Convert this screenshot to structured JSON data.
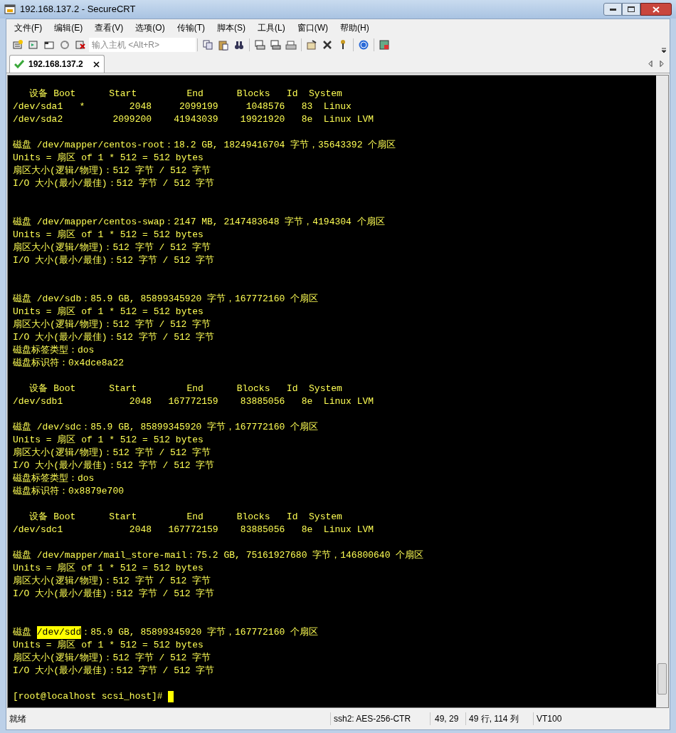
{
  "window": {
    "title": "192.168.137.2 - SecureCRT"
  },
  "menu": [
    "文件(F)",
    "编辑(E)",
    "查看(V)",
    "选项(O)",
    "传输(T)",
    "脚本(S)",
    "工具(L)",
    "窗口(W)",
    "帮助(H)"
  ],
  "toolbar": {
    "host_field": {
      "placeholder": "输入主机 <Alt+R>"
    }
  },
  "tabs": [
    {
      "label": "192.168.137.2",
      "selected": true,
      "connected": true
    }
  ],
  "terminal": {
    "lines": [
      {
        "kind": "text",
        "text": "   设备 Boot      Start         End      Blocks   Id  System"
      },
      {
        "kind": "text",
        "text": "/dev/sda1   *        2048     2099199     1048576   83  Linux"
      },
      {
        "kind": "text",
        "text": "/dev/sda2         2099200    41943039    19921920   8e  Linux LVM"
      },
      {
        "kind": "blank"
      },
      {
        "kind": "text",
        "text": "磁盘 /dev/mapper/centos-root：18.2 GB, 18249416704 字节，35643392 个扇区"
      },
      {
        "kind": "text",
        "text": "Units = 扇区 of 1 * 512 = 512 bytes"
      },
      {
        "kind": "text",
        "text": "扇区大小(逻辑/物理)：512 字节 / 512 字节"
      },
      {
        "kind": "text",
        "text": "I/O 大小(最小/最佳)：512 字节 / 512 字节"
      },
      {
        "kind": "blank"
      },
      {
        "kind": "blank"
      },
      {
        "kind": "text",
        "text": "磁盘 /dev/mapper/centos-swap：2147 MB, 2147483648 字节，4194304 个扇区"
      },
      {
        "kind": "text",
        "text": "Units = 扇区 of 1 * 512 = 512 bytes"
      },
      {
        "kind": "text",
        "text": "扇区大小(逻辑/物理)：512 字节 / 512 字节"
      },
      {
        "kind": "text",
        "text": "I/O 大小(最小/最佳)：512 字节 / 512 字节"
      },
      {
        "kind": "blank"
      },
      {
        "kind": "blank"
      },
      {
        "kind": "text",
        "text": "磁盘 /dev/sdb：85.9 GB, 85899345920 字节，167772160 个扇区"
      },
      {
        "kind": "text",
        "text": "Units = 扇区 of 1 * 512 = 512 bytes"
      },
      {
        "kind": "text",
        "text": "扇区大小(逻辑/物理)：512 字节 / 512 字节"
      },
      {
        "kind": "text",
        "text": "I/O 大小(最小/最佳)：512 字节 / 512 字节"
      },
      {
        "kind": "text",
        "text": "磁盘标签类型：dos"
      },
      {
        "kind": "text",
        "text": "磁盘标识符：0x4dce8a22"
      },
      {
        "kind": "blank"
      },
      {
        "kind": "text",
        "text": "   设备 Boot      Start         End      Blocks   Id  System"
      },
      {
        "kind": "text",
        "text": "/dev/sdb1            2048   167772159    83885056   8e  Linux LVM"
      },
      {
        "kind": "blank"
      },
      {
        "kind": "text",
        "text": "磁盘 /dev/sdc：85.9 GB, 85899345920 字节，167772160 个扇区"
      },
      {
        "kind": "text",
        "text": "Units = 扇区 of 1 * 512 = 512 bytes"
      },
      {
        "kind": "text",
        "text": "扇区大小(逻辑/物理)：512 字节 / 512 字节"
      },
      {
        "kind": "text",
        "text": "I/O 大小(最小/最佳)：512 字节 / 512 字节"
      },
      {
        "kind": "text",
        "text": "磁盘标签类型：dos"
      },
      {
        "kind": "text",
        "text": "磁盘标识符：0x8879e700"
      },
      {
        "kind": "blank"
      },
      {
        "kind": "text",
        "text": "   设备 Boot      Start         End      Blocks   Id  System"
      },
      {
        "kind": "text",
        "text": "/dev/sdc1            2048   167772159    83885056   8e  Linux LVM"
      },
      {
        "kind": "blank"
      },
      {
        "kind": "text",
        "text": "磁盘 /dev/mapper/mail_store-mail：75.2 GB, 75161927680 字节，146800640 个扇区"
      },
      {
        "kind": "text",
        "text": "Units = 扇区 of 1 * 512 = 512 bytes"
      },
      {
        "kind": "text",
        "text": "扇区大小(逻辑/物理)：512 字节 / 512 字节"
      },
      {
        "kind": "text",
        "text": "I/O 大小(最小/最佳)：512 字节 / 512 字节"
      },
      {
        "kind": "blank"
      },
      {
        "kind": "blank"
      },
      {
        "kind": "segments",
        "segments": [
          {
            "text": "磁盘 ",
            "highlighted": false
          },
          {
            "text": "/dev/sdd",
            "highlighted": true
          },
          {
            "text": "：85.9 GB, 85899345920 字节，167772160 个扇区",
            "highlighted": false
          }
        ]
      },
      {
        "kind": "text",
        "text": "Units = 扇区 of 1 * 512 = 512 bytes"
      },
      {
        "kind": "text",
        "text": "扇区大小(逻辑/物理)：512 字节 / 512 字节"
      },
      {
        "kind": "text",
        "text": "I/O 大小(最小/最佳)：512 字节 / 512 字节"
      },
      {
        "kind": "blank"
      },
      {
        "kind": "prompt",
        "text": "[root@localhost scsi_host]# ",
        "cursor": true
      }
    ]
  },
  "status_bar": {
    "status": "就绪",
    "cipher": "ssh2: AES-256-CTR",
    "position": "49, 29",
    "size": "49 行, 114 列",
    "emulation": "VT100"
  }
}
